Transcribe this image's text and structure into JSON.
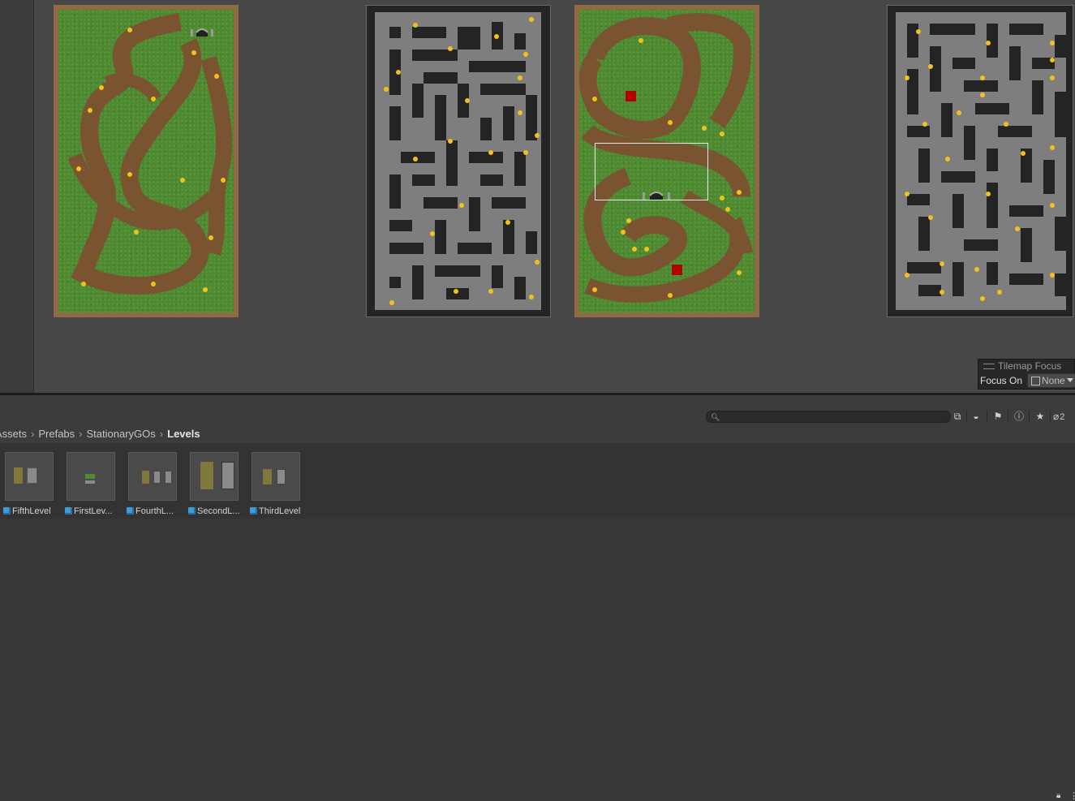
{
  "scene": {
    "levels": [
      {
        "name": "grass-level-1",
        "type": "grass"
      },
      {
        "name": "dungeon-level-1",
        "type": "dungeon"
      },
      {
        "name": "grass-level-2",
        "type": "grass"
      },
      {
        "name": "dungeon-level-2",
        "type": "dungeon"
      }
    ]
  },
  "tilemap_focus": {
    "title": "Tilemap Focus",
    "label": "Focus On",
    "value": "None"
  },
  "toolbar": {
    "search_placeholder": "",
    "hidden_count": "2"
  },
  "breadcrumb": [
    "Assets",
    "Prefabs",
    "StationaryGOs",
    "Levels"
  ],
  "assets": [
    {
      "label": "FifthLevel"
    },
    {
      "label": "FirstLev..."
    },
    {
      "label": "FourthL..."
    },
    {
      "label": "SecondL..."
    },
    {
      "label": "ThirdLevel"
    }
  ],
  "colors": {
    "grass": "#4f8a33",
    "path": "#7a5330",
    "frame": "#8e6b45",
    "wall": "#242424",
    "floor": "#7e7e7e",
    "coin": "#f2c21a",
    "marker": "#b00000"
  }
}
